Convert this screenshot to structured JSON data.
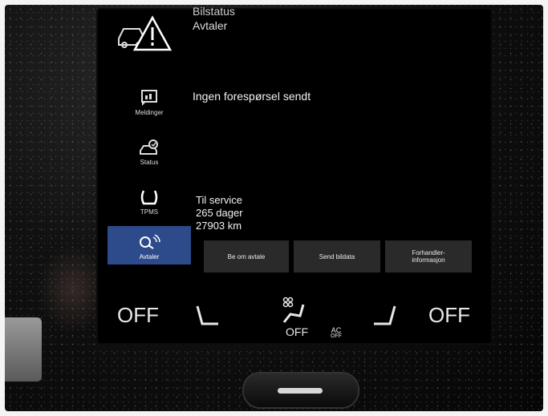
{
  "header": {
    "title_partial": "Bilstatus",
    "subtitle": "Avtaler"
  },
  "sidebar": {
    "items": [
      {
        "label": "Meldinger",
        "icon": "messages-icon"
      },
      {
        "label": "Status",
        "icon": "car-status-icon"
      },
      {
        "label": "TPMS",
        "icon": "tire-pressure-icon"
      },
      {
        "label": "Avtaler",
        "icon": "service-icon",
        "active": true
      }
    ]
  },
  "main": {
    "message": "Ingen forespørsel sendt",
    "service": {
      "title": "Til service",
      "days": "265 dager",
      "distance": "27903 km"
    },
    "buttons": [
      {
        "label": "Be om avtale"
      },
      {
        "label": "Send bildata"
      },
      {
        "label": "Forhandler-informasjon"
      }
    ]
  },
  "climate": {
    "left_temp": "OFF",
    "right_temp": "OFF",
    "center_fan": "OFF",
    "ac_label": "AC",
    "ac_state": "OFF"
  },
  "colors": {
    "active_tab": "#2d4a8a",
    "button_bg": "#2a2a2a",
    "screen_bg": "#000000"
  }
}
